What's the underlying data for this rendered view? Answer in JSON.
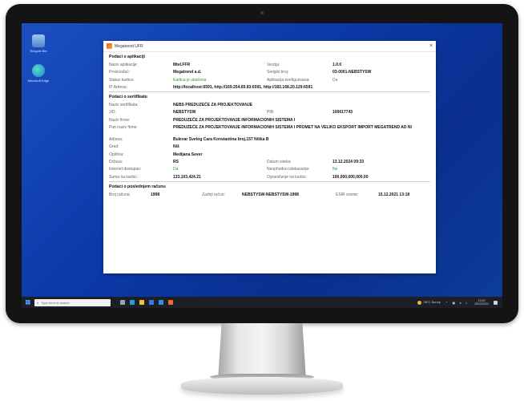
{
  "desktop": {
    "icons": [
      {
        "label": "Recycle Bin",
        "icon": "recycle-bin-icon"
      },
      {
        "label": "Microsoft Edge",
        "icon": "edge-browser-icon"
      }
    ]
  },
  "window": {
    "title": "Megatrend UFR",
    "close_glyph": "×",
    "app_icon": "megatrend-app-icon",
    "app_section": {
      "title": "Podaci o aplikaciji",
      "naziv_label": "Naziv aplikacije:",
      "naziv_value": "Mtel.FFR",
      "verzija_label": "Verzija:",
      "verzija_value": "1.0.0",
      "proizvodjac_label": "Proizvođač:",
      "proizvodjac_value": "Megatrend a.d.",
      "serijski_label": "Serijski broj:",
      "serijski_value": "03-0001-NEBSTYSW",
      "status_label": "Status kartice:",
      "status_value": "Kartica je ubačena",
      "konfig_label": "Aplikacija konfigurisana:",
      "konfig_value": "Da",
      "ip_label": "IP Adresa:",
      "ip_value": "http://localhost:6591, http://169.254.69.83:6591, http://192.168.20.129:6591"
    },
    "cert_section": {
      "title": "Podaci o sertifikatu",
      "naziv_label": "Naziv sertifikata:",
      "naziv_value": "NEBS PREDUZEĆE ZA PROJEKTOVANJE",
      "jid_label": "JID:",
      "jid_value": "NEBSTYSW",
      "pib_label": "PIB:",
      "pib_value": "100617743",
      "firma_label": "Naziv firme:",
      "firma_value": "PREDUZEĆE ZA PROJEKTOVANJE INFORMACIONIH SISTEMA I",
      "pun_label": "Pun naziv firme:",
      "pun_value": "PREDUZEĆE ZA PROJEKTOVANJE INFORMACIONIH SISTEMA I PROMET NA VELIKO EKSPORT IMPORT MEGATREND AD NI",
      "adresa_label": "Adresa:",
      "adresa_value": "Bulevar Svetog Cara Konstantina broj.157 Niška B",
      "grad_label": "Grad:",
      "grad_value": "Niš",
      "opstina_label": "Opština:",
      "opstina_value": "Medijana Sever",
      "drzava_label": "Država:",
      "drzava_value": "RS",
      "datum_label": "Datum isteka:",
      "datum_value": "13.12.2024 09:33",
      "internet_label": "Internet dostupan:",
      "internet_value": "Da",
      "neophodno_label": "Neophodno istekavanje:",
      "neophodno_value": "Ne",
      "suma_label": "Suma na kartici:",
      "suma_value": "133,103,424.21",
      "ogran_label": "Ograničenje na kartici:",
      "ogran_value": "100,000,000,000.00"
    },
    "receipt_section": {
      "title": "Podaci o poslednjem računu",
      "broj_label": "Broj računa:",
      "broj_value": "1998",
      "zadnji_label": "Zadnji račun:",
      "zadnji_value": "NEBSTYSW-NEBSTYSW-1998",
      "esir_label": "ESIR vreme:",
      "esir_value": "15.12.2021 13:18"
    }
  },
  "taskbar": {
    "search_placeholder": "Type here to search",
    "search_icon": "search-icon",
    "apps": [
      {
        "name": "task-view",
        "color": "#9aa4b8"
      },
      {
        "name": "edge",
        "color": "#2a9bd8"
      },
      {
        "name": "explorer",
        "color": "#f3c43a"
      },
      {
        "name": "store",
        "color": "#3c7be0"
      },
      {
        "name": "mail",
        "color": "#3a8fe0"
      },
      {
        "name": "megatrend",
        "color": "#e8702a"
      }
    ],
    "weather": "28°C Sunny",
    "time": "13:20",
    "date": "15/12/2021"
  }
}
